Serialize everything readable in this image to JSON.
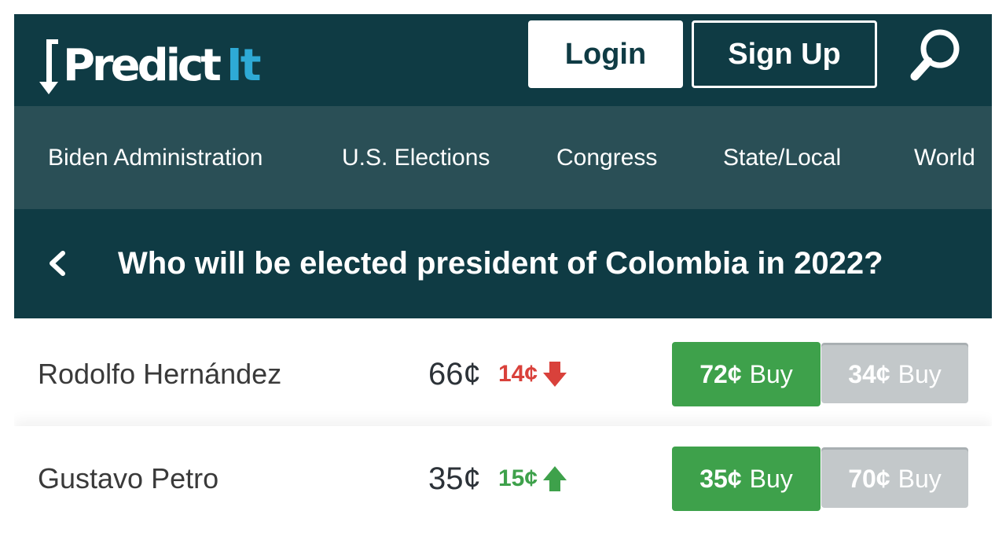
{
  "header": {
    "logo_text": "Predict",
    "logo_accent": "It",
    "login_label": "Login",
    "signup_label": "Sign Up",
    "search_icon": "search-icon"
  },
  "nav": {
    "items": [
      {
        "label": "Biden Administration"
      },
      {
        "label": "U.S. Elections"
      },
      {
        "label": "Congress"
      },
      {
        "label": "State/Local"
      },
      {
        "label": "World"
      }
    ]
  },
  "market": {
    "title": "Who will be elected president of Colombia in 2022?",
    "back_icon": "chevron-left-icon"
  },
  "contracts": [
    {
      "name": "Rodolfo Hernández",
      "last_price": "66¢",
      "change": "14¢",
      "direction": "down",
      "change_color": "#d9413b",
      "yes_price": "72¢",
      "yes_label": "Buy",
      "no_price": "34¢",
      "no_label": "Buy"
    },
    {
      "name": "Gustavo Petro",
      "last_price": "35¢",
      "change": "15¢",
      "direction": "up",
      "change_color": "#3ea14b",
      "yes_price": "35¢",
      "yes_label": "Buy",
      "no_price": "70¢",
      "no_label": "Buy"
    }
  ],
  "colors": {
    "header_bg": "#0f3b44",
    "nav_bg": "#2a4f56",
    "accent": "#2eaad6",
    "buy_yes": "#3ea14b",
    "buy_no": "#c3c8ca"
  }
}
